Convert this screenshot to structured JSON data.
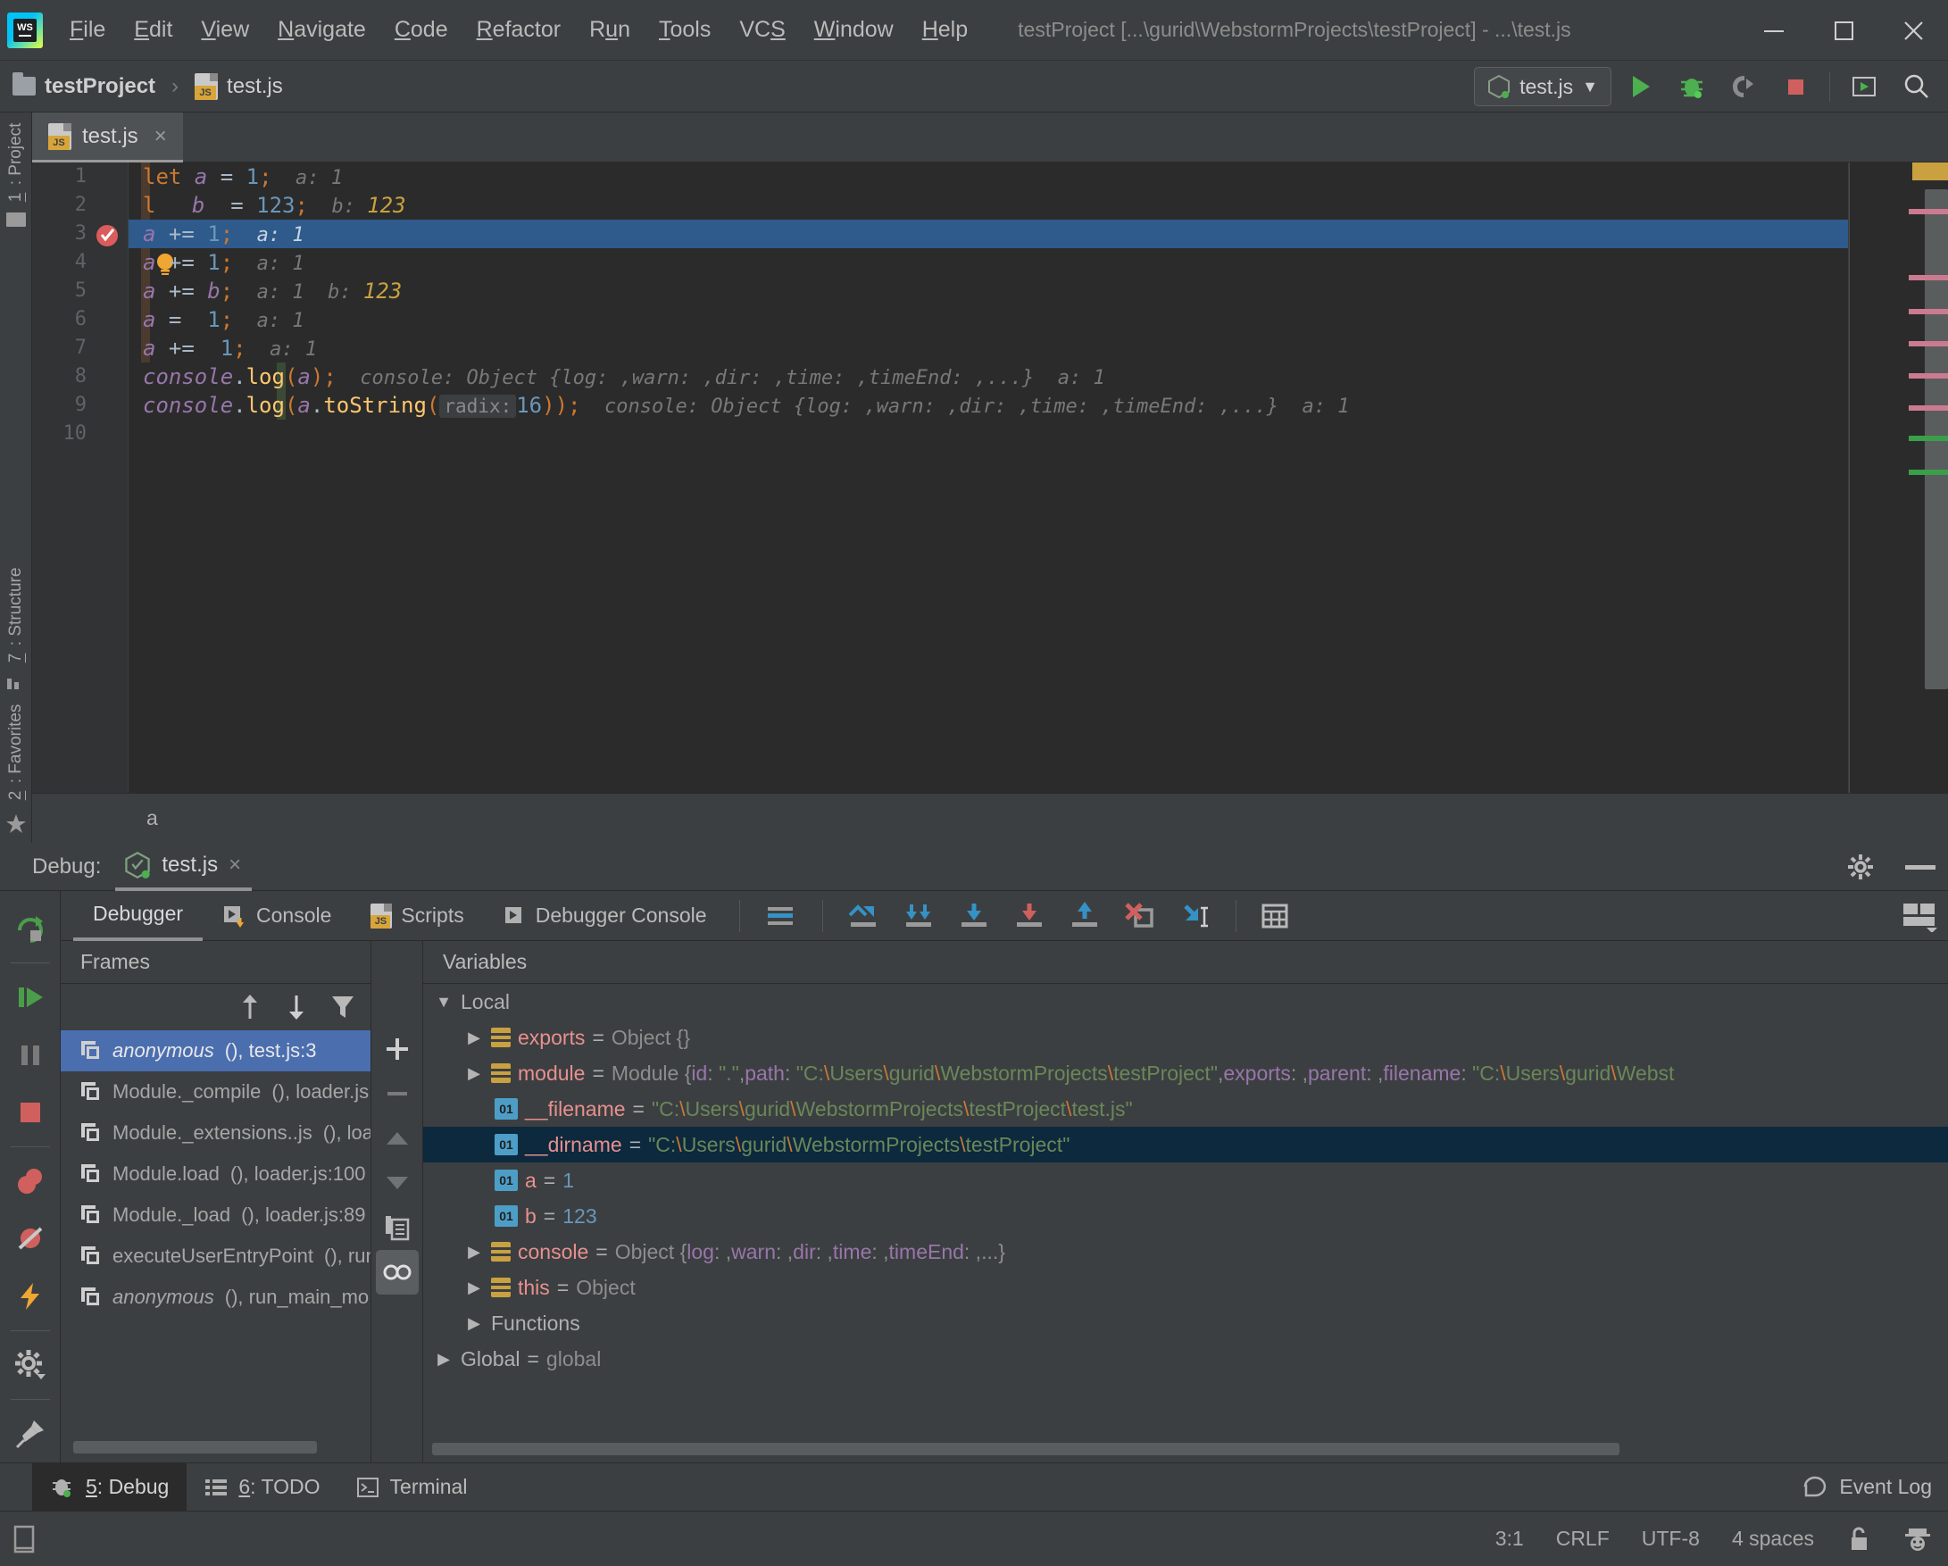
{
  "titlebar": {
    "logo_text": "WS",
    "menus": [
      {
        "label": "File",
        "mnemonic": "F"
      },
      {
        "label": "Edit",
        "mnemonic": "E"
      },
      {
        "label": "View",
        "mnemonic": "V"
      },
      {
        "label": "Navigate",
        "mnemonic": "N"
      },
      {
        "label": "Code",
        "mnemonic": "C"
      },
      {
        "label": "Refactor",
        "mnemonic": "R"
      },
      {
        "label": "Run",
        "mnemonic": "u"
      },
      {
        "label": "Tools",
        "mnemonic": "T"
      },
      {
        "label": "VCS",
        "mnemonic": "S"
      },
      {
        "label": "Window",
        "mnemonic": "W"
      },
      {
        "label": "Help",
        "mnemonic": "H"
      }
    ],
    "window_title": "testProject [...\\gurid\\WebstormProjects\\testProject] - ...\\test.js",
    "minimize_label": "Minimize",
    "maximize_label": "Maximize",
    "close_label": "Close"
  },
  "navbar": {
    "project_name": "testProject",
    "separator": "›",
    "file_name": "test.js",
    "run_config": "test.js",
    "dropdown_caret": "▼",
    "buttons": [
      "run-button",
      "debug-button",
      "run-coverage-button",
      "stop-button",
      "open-in-browser-button",
      "search-everywhere-button"
    ]
  },
  "left_tool_strip": {
    "top": [
      {
        "label": "1: Project",
        "mnemonic": "1"
      }
    ],
    "bottom": [
      {
        "label": "7: Structure",
        "mnemonic": "7"
      },
      {
        "label": "2: Favorites",
        "mnemonic": "2"
      }
    ]
  },
  "editor": {
    "tab_label": "test.js",
    "tab_close": "×",
    "breadcrumb": "a",
    "line_numbers": [
      "1",
      "2",
      "3",
      "4",
      "5",
      "6",
      "7",
      "8",
      "9",
      "10"
    ],
    "current_line": 3,
    "lines": [
      {
        "n": 1,
        "tokens": [
          {
            "t": "let",
            "c": "k"
          },
          {
            "t": " ",
            "c": "op"
          },
          {
            "t": "a",
            "c": "vr"
          },
          {
            "t": " = ",
            "c": "op"
          },
          {
            "t": "1",
            "c": "num"
          },
          {
            "t": ";",
            "c": "pn"
          }
        ],
        "hint": "a: 1"
      },
      {
        "n": 2,
        "tokens": [
          {
            "t": "l",
            "c": "k"
          },
          {
            "t": "  ",
            "c": "bulb"
          },
          {
            "t": " b",
            "c": "vr"
          },
          {
            "t": "  = ",
            "c": "op"
          },
          {
            "t": "123",
            "c": "num"
          },
          {
            "t": ";",
            "c": "pn"
          }
        ],
        "hint": "b: ",
        "hint_num": "123"
      },
      {
        "n": 3,
        "tokens": [
          {
            "t": "a",
            "c": "vr"
          },
          {
            "t": " += ",
            "c": "op"
          },
          {
            "t": "1",
            "c": "num"
          },
          {
            "t": ";",
            "c": "pn"
          }
        ],
        "hint": "a: 1"
      },
      {
        "n": 4,
        "tokens": [
          {
            "t": "a",
            "c": "vr"
          },
          {
            "t": " += ",
            "c": "op"
          },
          {
            "t": "1",
            "c": "num"
          },
          {
            "t": ";",
            "c": "pn"
          }
        ],
        "hint": "a: 1"
      },
      {
        "n": 5,
        "tokens": [
          {
            "t": "a",
            "c": "vr"
          },
          {
            "t": " += ",
            "c": "op"
          },
          {
            "t": "b",
            "c": "vr"
          },
          {
            "t": ";",
            "c": "pn"
          }
        ],
        "hint": "a: 1  b: ",
        "hint_num": "123"
      },
      {
        "n": 6,
        "tokens": [
          {
            "t": "a",
            "c": "vr"
          },
          {
            "t": " =  ",
            "c": "op"
          },
          {
            "t": "1",
            "c": "num"
          },
          {
            "t": ";",
            "c": "pn"
          }
        ],
        "hint": "a: 1"
      },
      {
        "n": 7,
        "tokens": [
          {
            "t": "a",
            "c": "vr"
          },
          {
            "t": " +=  ",
            "c": "op"
          },
          {
            "t": "1",
            "c": "num"
          },
          {
            "t": ";",
            "c": "pn"
          }
        ],
        "hint": "a: 1"
      },
      {
        "n": 8,
        "tokens": [
          {
            "t": "console",
            "c": "obj"
          },
          {
            "t": ".",
            "c": "op"
          },
          {
            "t": "log",
            "c": "fn"
          },
          {
            "t": "(",
            "c": "pn"
          },
          {
            "t": "a",
            "c": "vr"
          },
          {
            "t": ")",
            "c": "pn"
          },
          {
            "t": ";",
            "c": "pn"
          }
        ],
        "hint": "console: Object {log: ,warn: ,dir: ,time: ,timeEnd: ,...}  a: 1"
      },
      {
        "n": 9,
        "tokens": [
          {
            "t": "console",
            "c": "obj"
          },
          {
            "t": ".",
            "c": "op"
          },
          {
            "t": "log",
            "c": "fn"
          },
          {
            "t": "(",
            "c": "pn"
          },
          {
            "t": "a",
            "c": "vr"
          },
          {
            "t": ".",
            "c": "op"
          },
          {
            "t": "toString",
            "c": "fn"
          },
          {
            "t": "(",
            "c": "pn"
          },
          {
            "t": "radix:",
            "c": "chip"
          },
          {
            "t": "16",
            "c": "num"
          },
          {
            "t": ")",
            "c": "pn"
          },
          {
            "t": ")",
            "c": "pn"
          },
          {
            "t": ";",
            "c": "pn"
          }
        ],
        "hint": "console: Object {log: ,warn: ,dir: ,time: ,timeEnd: ,...}  a: 1"
      },
      {
        "n": 10,
        "tokens": [],
        "hint": ""
      }
    ],
    "breakpoint_line": 3,
    "bulb_line": 2
  },
  "debug": {
    "title_prefix": "Debug:",
    "session_tab": "test.js",
    "session_close": "×",
    "settings_icon": "gear-icon",
    "minimize_icon": "minimize-icon",
    "tabs": [
      {
        "label": "Debugger",
        "icon": "",
        "active": true
      },
      {
        "label": "Console",
        "icon": "console-icon",
        "active": false
      },
      {
        "label": "Scripts",
        "icon": "js-file-icon",
        "active": false
      },
      {
        "label": "Debugger Console",
        "icon": "terminal-icon",
        "active": false
      }
    ],
    "toolbar_icons": [
      "mute-breakpoints-icon",
      "show-execution-point-icon",
      "step-over-icon",
      "step-into-icon",
      "force-step-into-icon",
      "step-out-icon",
      "drop-frame-icon",
      "run-to-cursor-icon",
      "evaluate-expression-icon"
    ],
    "left_actions": [
      "rerun-icon",
      "resume-program-icon",
      "pause-program-icon",
      "stop-icon",
      "view-breakpoints-icon",
      "mute-breakpoints-icon",
      "force-run-to-cursor-icon",
      "settings-icon",
      "pin-tab-icon"
    ],
    "frames": {
      "header": "Frames",
      "tools": [
        "thread-up-icon",
        "thread-down-icon",
        "filter-icon"
      ],
      "items": [
        {
          "fn": "anonymous",
          "rest": "(), test.js:3",
          "italic": true,
          "selected": true
        },
        {
          "fn": "Module._compile",
          "rest": "(), loader.js",
          "italic": false,
          "selected": false
        },
        {
          "fn": "Module._extensions..js",
          "rest": "(), loa",
          "italic": false,
          "selected": false
        },
        {
          "fn": "Module.load",
          "rest": "(), loader.js:100",
          "italic": false,
          "selected": false
        },
        {
          "fn": "Module._load",
          "rest": "(), loader.js:89",
          "italic": false,
          "selected": false
        },
        {
          "fn": "executeUserEntryPoint",
          "rest": "(), run",
          "italic": false,
          "selected": false
        },
        {
          "fn": "anonymous",
          "rest": "(), run_main_mo",
          "italic": true,
          "selected": false
        }
      ]
    },
    "mid_buttons": [
      "add-watch-icon",
      "remove-watch-icon",
      "move-up-icon",
      "move-down-icon",
      "copy-value-icon",
      "inspect-icon"
    ],
    "variables": {
      "header": "Variables",
      "rows": [
        {
          "indent": 0,
          "tri": "▼",
          "icon": "none",
          "name": "Local",
          "name_class": "vplain",
          "eq": "",
          "value_parts": []
        },
        {
          "indent": 1,
          "tri": "▶",
          "icon": "obj",
          "name": "exports",
          "name_class": "vname",
          "eq": " = ",
          "value_parts": [
            {
              "t": "Object {}",
              "c": "vtype"
            }
          ]
        },
        {
          "indent": 1,
          "tri": "▶",
          "icon": "obj",
          "name": "module",
          "name_class": "vname",
          "eq": " = ",
          "value_parts": [
            {
              "t": "Module {",
              "c": "vtype"
            },
            {
              "t": "id",
              "c": "vkey"
            },
            {
              "t": ": ",
              "c": "vtype"
            },
            {
              "t": "\".\"",
              "c": "vstr"
            },
            {
              "t": ",",
              "c": "vtype"
            },
            {
              "t": "path",
              "c": "vkey"
            },
            {
              "t": ": ",
              "c": "vtype"
            },
            {
              "t": "\"C:",
              "c": "vstr"
            },
            {
              "t": "\\",
              "c": "vslash"
            },
            {
              "t": "Users",
              "c": "vstr"
            },
            {
              "t": "\\",
              "c": "vslash"
            },
            {
              "t": "gurid",
              "c": "vstr"
            },
            {
              "t": "\\",
              "c": "vslash"
            },
            {
              "t": "WebstormProjects",
              "c": "vstr"
            },
            {
              "t": "\\",
              "c": "vslash"
            },
            {
              "t": "testProject\"",
              "c": "vstr"
            },
            {
              "t": ",",
              "c": "vtype"
            },
            {
              "t": "exports",
              "c": "vkey"
            },
            {
              "t": ": ,",
              "c": "vtype"
            },
            {
              "t": "parent",
              "c": "vkey"
            },
            {
              "t": ": ,",
              "c": "vtype"
            },
            {
              "t": "filename",
              "c": "vkey"
            },
            {
              "t": ": ",
              "c": "vtype"
            },
            {
              "t": "\"C:",
              "c": "vstr"
            },
            {
              "t": "\\",
              "c": "vslash"
            },
            {
              "t": "Users",
              "c": "vstr"
            },
            {
              "t": "\\",
              "c": "vslash"
            },
            {
              "t": "gurid",
              "c": "vstr"
            },
            {
              "t": "\\",
              "c": "vslash"
            },
            {
              "t": "Webst",
              "c": "vstr"
            }
          ]
        },
        {
          "indent": 2,
          "tri": "",
          "icon": "prim",
          "icon_text": "01",
          "name": "__filename",
          "name_class": "vname",
          "eq": " = ",
          "value_parts": [
            {
              "t": "\"C:",
              "c": "vstr"
            },
            {
              "t": "\\",
              "c": "vslash"
            },
            {
              "t": "Users",
              "c": "vstr"
            },
            {
              "t": "\\",
              "c": "vslash"
            },
            {
              "t": "gurid",
              "c": "vstr"
            },
            {
              "t": "\\",
              "c": "vslash"
            },
            {
              "t": "WebstormProjects",
              "c": "vstr"
            },
            {
              "t": "\\",
              "c": "vslash"
            },
            {
              "t": "testProject",
              "c": "vstr"
            },
            {
              "t": "\\",
              "c": "vslash"
            },
            {
              "t": "test.js\"",
              "c": "vstr"
            }
          ]
        },
        {
          "indent": 2,
          "tri": "",
          "icon": "prim",
          "icon_text": "01",
          "name": "__dirname",
          "name_class": "vname",
          "eq": " = ",
          "selected": true,
          "value_parts": [
            {
              "t": "\"C:",
              "c": "vstr"
            },
            {
              "t": "\\",
              "c": "vslash"
            },
            {
              "t": "Users",
              "c": "vstr"
            },
            {
              "t": "\\",
              "c": "vslash"
            },
            {
              "t": "gurid",
              "c": "vstr"
            },
            {
              "t": "\\",
              "c": "vslash"
            },
            {
              "t": "WebstormProjects",
              "c": "vstr"
            },
            {
              "t": "\\",
              "c": "vslash"
            },
            {
              "t": "testProject\"",
              "c": "vstr"
            }
          ]
        },
        {
          "indent": 2,
          "tri": "",
          "icon": "prim",
          "icon_text": "01",
          "name": "a",
          "name_class": "vname",
          "eq": " = ",
          "value_parts": [
            {
              "t": "1",
              "c": "vnum"
            }
          ]
        },
        {
          "indent": 2,
          "tri": "",
          "icon": "prim",
          "icon_text": "01",
          "name": "b",
          "name_class": "vname",
          "eq": " = ",
          "value_parts": [
            {
              "t": "123",
              "c": "vnum"
            }
          ]
        },
        {
          "indent": 1,
          "tri": "▶",
          "icon": "obj",
          "name": "console",
          "name_class": "vname",
          "eq": " = ",
          "value_parts": [
            {
              "t": "Object {",
              "c": "vtype"
            },
            {
              "t": "log",
              "c": "vkey"
            },
            {
              "t": ": ,",
              "c": "vtype"
            },
            {
              "t": "warn",
              "c": "vkey"
            },
            {
              "t": ": ,",
              "c": "vtype"
            },
            {
              "t": "dir",
              "c": "vkey"
            },
            {
              "t": ": ,",
              "c": "vtype"
            },
            {
              "t": "time",
              "c": "vkey"
            },
            {
              "t": ": ,",
              "c": "vtype"
            },
            {
              "t": "timeEnd",
              "c": "vkey"
            },
            {
              "t": ": ,",
              "c": "vtype"
            },
            {
              "t": "...}",
              "c": "vtype"
            }
          ]
        },
        {
          "indent": 1,
          "tri": "▶",
          "icon": "obj",
          "name": "this",
          "name_class": "vname",
          "eq": " = ",
          "value_parts": [
            {
              "t": "Object",
              "c": "vtype"
            }
          ]
        },
        {
          "indent": 1,
          "tri": "▶",
          "icon": "none",
          "name": "Functions",
          "name_class": "vplain",
          "eq": "",
          "value_parts": []
        },
        {
          "indent": 0,
          "tri": "▶",
          "icon": "none",
          "name": "Global",
          "name_class": "vplain",
          "eq": " = ",
          "value_parts": [
            {
              "t": "global",
              "c": "vtype"
            }
          ]
        }
      ]
    }
  },
  "bottom_toolwindows": [
    {
      "label": "5: Debug",
      "mnemonic": "5",
      "icon": "bug-icon",
      "active": true
    },
    {
      "label": "6: TODO",
      "mnemonic": "6",
      "icon": "todo-list-icon",
      "active": false
    },
    {
      "label": "Terminal",
      "mnemonic": "",
      "icon": "terminal-icon",
      "active": false
    }
  ],
  "event_log": {
    "label": "Event Log",
    "icon": "balloon-icon"
  },
  "statusbar": {
    "caret_position": "3:1",
    "line_separator": "CRLF",
    "encoding": "UTF-8",
    "indent": "4 spaces",
    "lock_icon": "unlocked-icon",
    "inspection_icon": "hector-icon"
  },
  "colors": {
    "bg": "#3c3f41",
    "editor_bg": "#2b2b2b",
    "gutter_bg": "#313335",
    "selection": "#2f5a8c",
    "frame_selection": "#4b6eaf",
    "var_selection": "#0d293e",
    "accent_green": "#4a9e4a",
    "accent_red": "#d0605e",
    "accent_blue": "#3592c4",
    "accent_yellow": "#d7a539",
    "string_green": "#6a8759",
    "keyword_orange": "#cc7832",
    "number_blue": "#6897bb"
  }
}
